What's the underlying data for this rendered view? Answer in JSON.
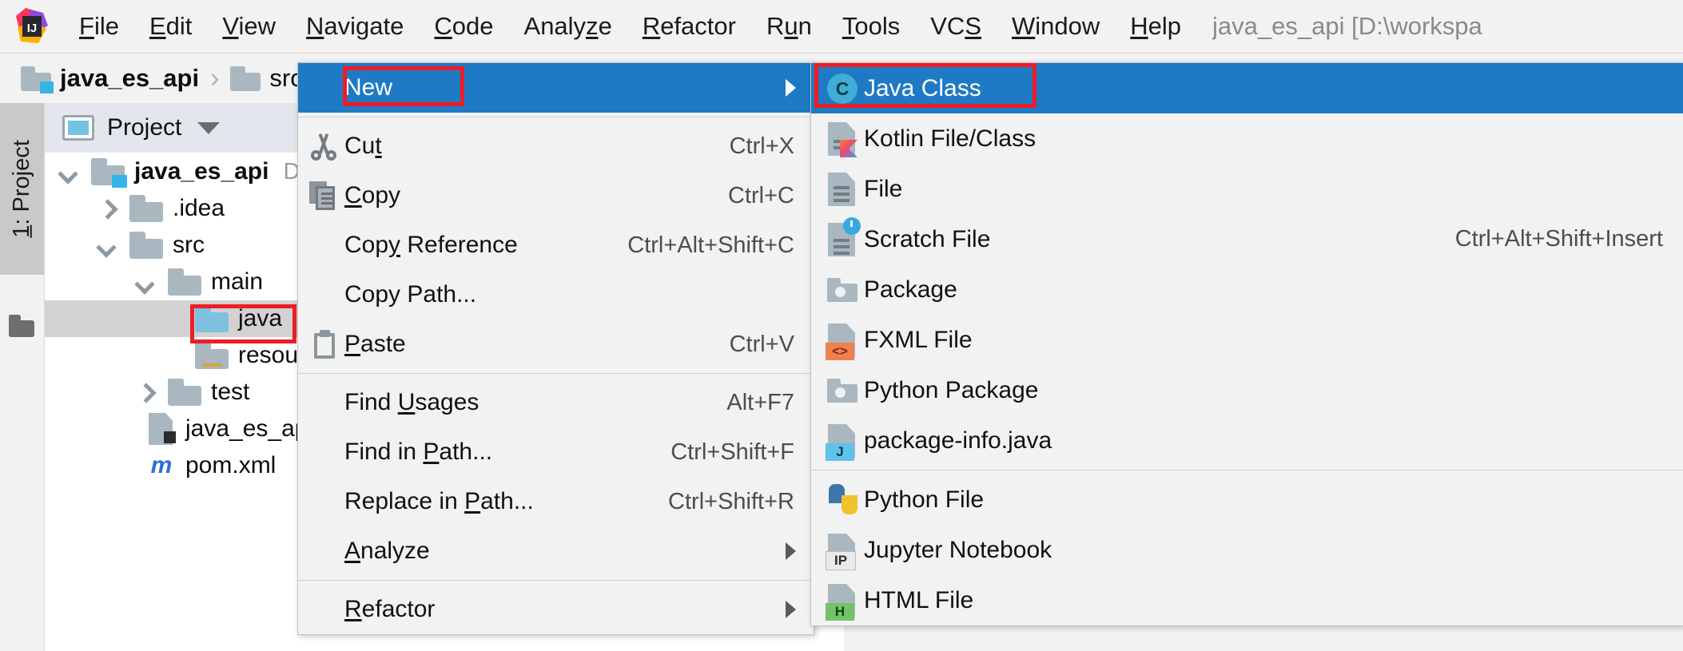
{
  "app": {
    "logo_icon": "intellij-idea-logo",
    "window_title": "java_es_api [D:\\workspa"
  },
  "menubar": {
    "items": [
      {
        "label": "File",
        "mnemonic": "F"
      },
      {
        "label": "Edit",
        "mnemonic": "E"
      },
      {
        "label": "View",
        "mnemonic": "V"
      },
      {
        "label": "Navigate",
        "mnemonic": "N"
      },
      {
        "label": "Code",
        "mnemonic": "C"
      },
      {
        "label": "Analyze",
        "mnemonic": "z"
      },
      {
        "label": "Refactor",
        "mnemonic": "R"
      },
      {
        "label": "Run",
        "mnemonic": "u"
      },
      {
        "label": "Tools",
        "mnemonic": "T"
      },
      {
        "label": "VCS",
        "mnemonic": "S"
      },
      {
        "label": "Window",
        "mnemonic": "W"
      },
      {
        "label": "Help",
        "mnemonic": "H"
      }
    ]
  },
  "breadcrumb": {
    "items": [
      {
        "label": "java_es_api",
        "icon": "folder-icon",
        "bold": true
      },
      {
        "label": "src",
        "icon": "folder-icon",
        "bold": false
      }
    ],
    "separator": "›"
  },
  "toolstrip": {
    "project_tab_prefix": "1",
    "project_tab_label": ": Project"
  },
  "project_panel": {
    "title": "Project",
    "panel_icon": "project-view-icon",
    "dropdown_icon": "chevron-down-icon",
    "tree": [
      {
        "label": "java_es_api",
        "path": "D:\\wo",
        "icon": "module-folder-icon",
        "indent": 0,
        "chevron": "down",
        "bold": true,
        "selected": false
      },
      {
        "label": ".idea",
        "path": "",
        "icon": "folder-icon",
        "indent": 1,
        "chevron": "right",
        "bold": false,
        "selected": false
      },
      {
        "label": "src",
        "path": "",
        "icon": "folder-icon",
        "indent": 1,
        "chevron": "down",
        "bold": false,
        "selected": false
      },
      {
        "label": "main",
        "path": "",
        "icon": "folder-icon",
        "indent": 2,
        "chevron": "down",
        "bold": false,
        "selected": false
      },
      {
        "label": "java",
        "path": "",
        "icon": "source-folder-icon",
        "indent": 3,
        "chevron": "none",
        "bold": false,
        "selected": true
      },
      {
        "label": "resourc",
        "path": "",
        "icon": "resources-folder-icon",
        "indent": 3,
        "chevron": "none",
        "bold": false,
        "selected": false
      },
      {
        "label": "test",
        "path": "",
        "icon": "folder-icon",
        "indent": 2,
        "chevron": "right",
        "bold": false,
        "selected": false
      },
      {
        "label": "java_es_api.iml",
        "path": "",
        "icon": "iml-file-icon",
        "indent": 1,
        "chevron": "none",
        "bold": false,
        "selected": false
      },
      {
        "label": "pom.xml",
        "path": "",
        "icon": "maven-file-icon",
        "indent": 1,
        "chevron": "none",
        "bold": false,
        "selected": false
      }
    ]
  },
  "context_menu": {
    "items": [
      {
        "label": "New",
        "mnemonic": "",
        "shortcut": "",
        "icon": "",
        "submenu": true,
        "highlighted": true,
        "separator_after": true
      },
      {
        "label": "Cut",
        "mnemonic": "t",
        "shortcut": "Ctrl+X",
        "icon": "scissors-icon",
        "submenu": false,
        "highlighted": false,
        "separator_after": false
      },
      {
        "label": "Copy",
        "mnemonic": "C",
        "shortcut": "Ctrl+C",
        "icon": "copy-icon",
        "submenu": false,
        "highlighted": false,
        "separator_after": false
      },
      {
        "label": "Copy Reference",
        "mnemonic": "y",
        "shortcut": "Ctrl+Alt+Shift+C",
        "icon": "",
        "submenu": false,
        "highlighted": false,
        "separator_after": false
      },
      {
        "label": "Copy Path...",
        "mnemonic": "",
        "shortcut": "",
        "icon": "",
        "submenu": false,
        "highlighted": false,
        "separator_after": false
      },
      {
        "label": "Paste",
        "mnemonic": "P",
        "shortcut": "Ctrl+V",
        "icon": "clipboard-icon",
        "submenu": false,
        "highlighted": false,
        "separator_after": true
      },
      {
        "label": "Find Usages",
        "mnemonic": "U",
        "shortcut": "Alt+F7",
        "icon": "",
        "submenu": false,
        "highlighted": false,
        "separator_after": false
      },
      {
        "label": "Find in Path...",
        "mnemonic": "P",
        "shortcut": "Ctrl+Shift+F",
        "icon": "",
        "submenu": false,
        "highlighted": false,
        "separator_after": false
      },
      {
        "label": "Replace in Path...",
        "mnemonic": "P",
        "shortcut": "Ctrl+Shift+R",
        "icon": "",
        "submenu": false,
        "highlighted": false,
        "separator_after": false
      },
      {
        "label": "Analyze",
        "mnemonic": "A",
        "shortcut": "",
        "icon": "",
        "submenu": true,
        "highlighted": false,
        "separator_after": true
      },
      {
        "label": "Refactor",
        "mnemonic": "R",
        "shortcut": "",
        "icon": "",
        "submenu": true,
        "highlighted": false,
        "separator_after": false
      }
    ]
  },
  "submenu": {
    "items": [
      {
        "label": "Java Class",
        "shortcut": "",
        "icon": "java-class-icon",
        "highlighted": true,
        "separator_after": false
      },
      {
        "label": "Kotlin File/Class",
        "shortcut": "",
        "icon": "kotlin-file-icon",
        "highlighted": false,
        "separator_after": false
      },
      {
        "label": "File",
        "shortcut": "",
        "icon": "file-icon",
        "highlighted": false,
        "separator_after": false
      },
      {
        "label": "Scratch File",
        "shortcut": "Ctrl+Alt+Shift+Insert",
        "icon": "scratch-file-icon",
        "highlighted": false,
        "separator_after": false
      },
      {
        "label": "Package",
        "shortcut": "",
        "icon": "package-icon",
        "highlighted": false,
        "separator_after": false
      },
      {
        "label": "FXML File",
        "shortcut": "",
        "icon": "fxml-file-icon",
        "highlighted": false,
        "separator_after": false
      },
      {
        "label": "Python Package",
        "shortcut": "",
        "icon": "python-package-icon",
        "highlighted": false,
        "separator_after": false
      },
      {
        "label": "package-info.java",
        "shortcut": "",
        "icon": "package-info-icon",
        "highlighted": false,
        "separator_after": true
      },
      {
        "label": "Python File",
        "shortcut": "",
        "icon": "python-file-icon",
        "highlighted": false,
        "separator_after": false
      },
      {
        "label": "Jupyter Notebook",
        "shortcut": "",
        "icon": "jupyter-notebook-icon",
        "highlighted": false,
        "separator_after": false
      },
      {
        "label": "HTML File",
        "shortcut": "",
        "icon": "html-file-icon",
        "highlighted": false,
        "separator_after": false
      }
    ]
  },
  "annotations": {
    "color": "#ee1c25",
    "boxes": [
      {
        "name": "new-menu-item-highlight"
      },
      {
        "name": "java-class-submenu-highlight"
      },
      {
        "name": "java-folder-tree-highlight"
      }
    ]
  }
}
